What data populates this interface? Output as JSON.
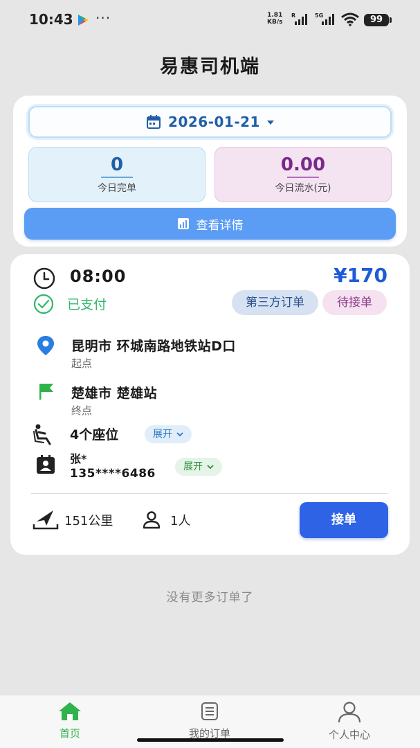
{
  "status_bar": {
    "time": "10:43",
    "dots": "···",
    "speed_value": "1.81",
    "speed_unit": "KB/s",
    "battery": "99"
  },
  "header": {
    "title": "易惠司机端"
  },
  "summary": {
    "date": "2026-01-21",
    "completed_value": "0",
    "completed_label": "今日完单",
    "revenue_value": "0.00",
    "revenue_label": "今日流水(元)",
    "detail_button": "查看详情"
  },
  "order": {
    "time": "08:00",
    "price": "¥170",
    "paid_status": "已支付",
    "tag_source": "第三方订单",
    "tag_status": "待接单",
    "origin_title": "昆明市 环城南路地铁站D口",
    "origin_label": "起点",
    "dest_title": "楚雄市 楚雄站",
    "dest_label": "终点",
    "seats": "4个座位",
    "expand_label": "展开",
    "passenger_name": "张*",
    "passenger_phone": "135****6486",
    "distance": "151公里",
    "people": "1人",
    "accept_button": "接单"
  },
  "list_footer": "没有更多订单了",
  "bottom_nav": {
    "home": "首页",
    "orders": "我的订单",
    "profile": "个人中心"
  },
  "colors": {
    "accent_blue": "#2e63e6",
    "paid_green": "#2fb86a",
    "home_green": "#2fb34a"
  }
}
